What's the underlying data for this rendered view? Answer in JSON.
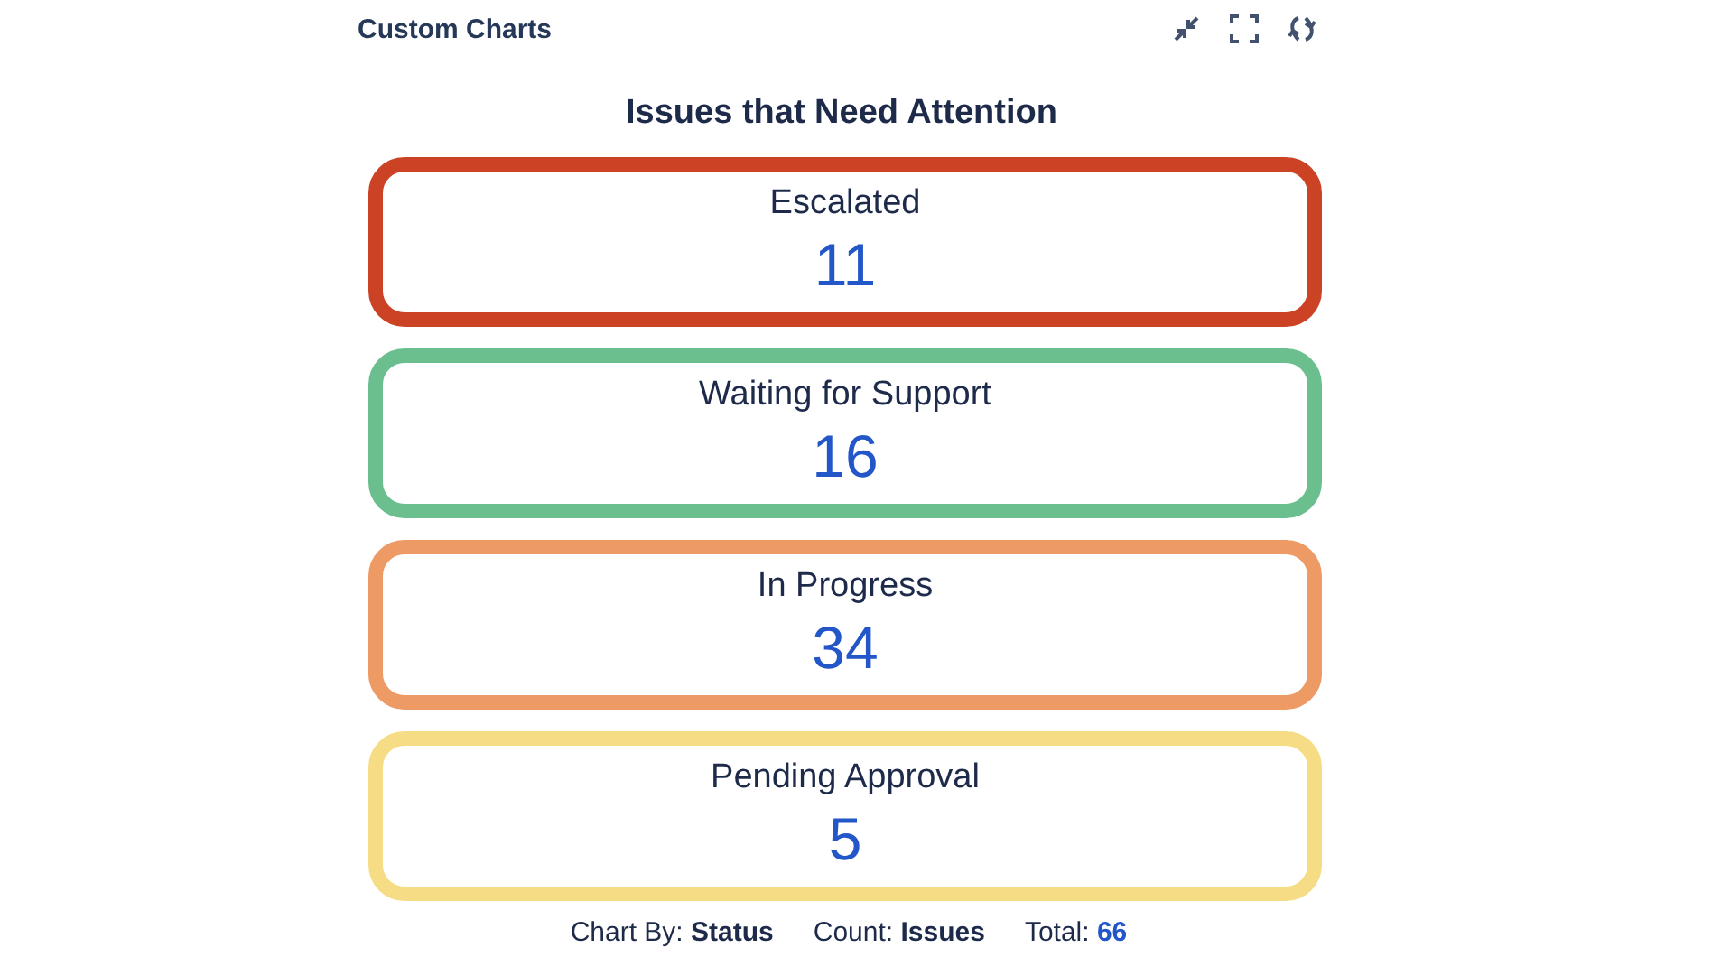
{
  "header": {
    "title": "Custom Charts"
  },
  "chart": {
    "title": "Issues that Need Attention",
    "cards": [
      {
        "label": "Escalated",
        "count": "11",
        "color": "#cc4224"
      },
      {
        "label": "Waiting for Support",
        "count": "16",
        "color": "#6bbf8e"
      },
      {
        "label": "In Progress",
        "count": "34",
        "color": "#ee9a65"
      },
      {
        "label": "Pending Approval",
        "count": "5",
        "color": "#f6dc84"
      }
    ]
  },
  "footer": [
    {
      "label": "Chart By:",
      "value": "Status",
      "kind": "plain"
    },
    {
      "label": "Count:",
      "value": "Issues",
      "kind": "plain"
    },
    {
      "label": "Total:",
      "value": "66",
      "kind": "highlight"
    }
  ]
}
